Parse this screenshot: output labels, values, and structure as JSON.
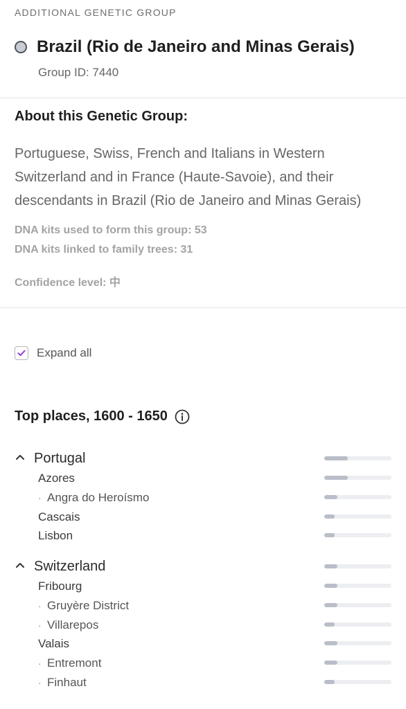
{
  "header": {
    "section_label": "ADDITIONAL GENETIC GROUP",
    "group_name": "Brazil (Rio de Janeiro and Minas Gerais)",
    "group_id": "Group ID: 7440"
  },
  "about": {
    "title": "About this Genetic Group:",
    "description": "Portuguese, Swiss, French and Italians in Western Switzerland and in France (Haute-Savoie), and their descendants in Brazil (Rio de Janeiro and Minas Gerais)",
    "kits_formed": "DNA kits used to form this group: 53",
    "kits_linked": "DNA kits linked to family trees: 31",
    "confidence": "Confidence level: 中"
  },
  "controls": {
    "expand_all_label": "Expand all",
    "expand_all_checked": true
  },
  "top_places": {
    "title": "Top places, 1600 - 1650",
    "countries": [
      {
        "name": "Portugal",
        "share": 0.35,
        "places": [
          {
            "name": "Azores",
            "share": 0.35,
            "sub": false
          },
          {
            "name": "Angra do Heroísmo",
            "share": 0.2,
            "sub": true
          },
          {
            "name": "Cascais",
            "share": 0.15,
            "sub": false
          },
          {
            "name": "Lisbon",
            "share": 0.15,
            "sub": false
          }
        ]
      },
      {
        "name": "Switzerland",
        "share": 0.2,
        "places": [
          {
            "name": "Fribourg",
            "share": 0.2,
            "sub": false
          },
          {
            "name": "Gruyère District",
            "share": 0.2,
            "sub": true
          },
          {
            "name": "Villarepos",
            "share": 0.15,
            "sub": true
          },
          {
            "name": "Valais",
            "share": 0.2,
            "sub": false
          },
          {
            "name": "Entremont",
            "share": 0.2,
            "sub": true
          },
          {
            "name": "Finhaut",
            "share": 0.15,
            "sub": true
          }
        ]
      }
    ]
  },
  "colors": {
    "accent_check": "#8e3fd1",
    "bar_fill": "#b9bec8",
    "bar_track": "#eceef2"
  }
}
